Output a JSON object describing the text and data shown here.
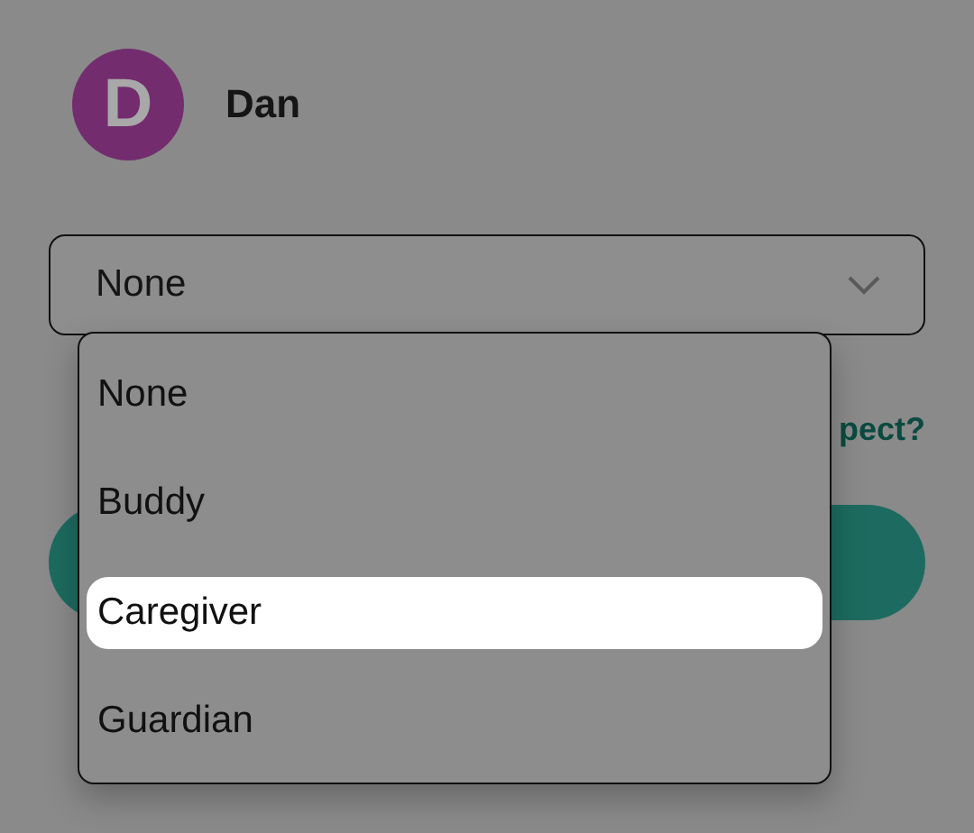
{
  "profile": {
    "initial": "D",
    "name": "Dan"
  },
  "select": {
    "value": "None",
    "expanded": true
  },
  "options": [
    {
      "label": "None",
      "selected": false
    },
    {
      "label": "Buddy",
      "selected": false
    },
    {
      "label": "Caregiver",
      "selected": true
    },
    {
      "label": "Guardian",
      "selected": false
    }
  ],
  "link": {
    "text": "pect?"
  }
}
